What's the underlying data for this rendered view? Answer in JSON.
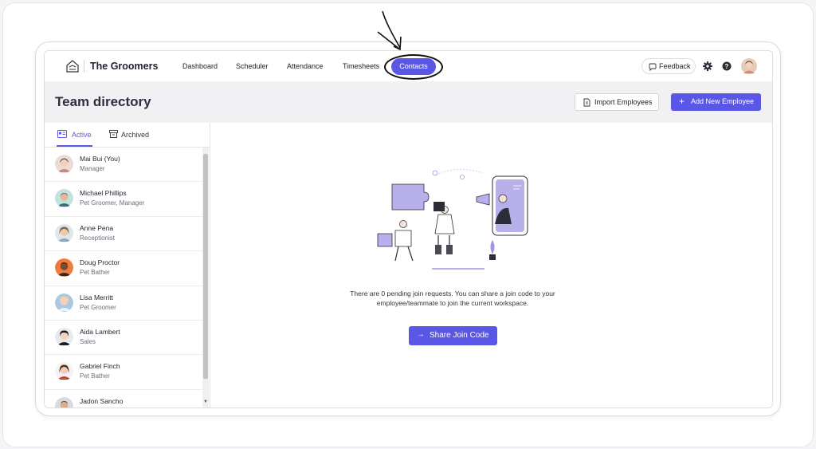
{
  "app": {
    "title": "The Groomers"
  },
  "nav": {
    "items": [
      "Dashboard",
      "Scheduler",
      "Attendance",
      "Timesheets"
    ],
    "active_item": "Contacts",
    "feedback_label": "Feedback"
  },
  "header": {
    "title": "Team directory",
    "import_label": "Import Employees",
    "add_label": "Add New Employee"
  },
  "tabs": {
    "active": "Active",
    "archived": "Archived"
  },
  "employees": [
    {
      "name": "Mai Bui (You)",
      "role": "Manager"
    },
    {
      "name": "Michael Phillips",
      "role": "Pet Groomer, Manager"
    },
    {
      "name": "Anne Pena",
      "role": "Receptionist"
    },
    {
      "name": "Doug Proctor",
      "role": "Pet Bather"
    },
    {
      "name": "Lisa Merritt",
      "role": "Pet Groomer"
    },
    {
      "name": "Aida Lambert",
      "role": "Sales"
    },
    {
      "name": "Gabriel Finch",
      "role": "Pet Bather"
    },
    {
      "name": "Jadon Sancho",
      "role": ""
    }
  ],
  "empty_state": {
    "message": "There are 0 pending join requests. You can share a join code to your employee/teammate to join the current workspace.",
    "button_label": "Share Join Code"
  },
  "colors": {
    "accent": "#5b57e6",
    "illustration": "#9f97e6"
  },
  "icons": [
    "logo-icon",
    "chat-icon",
    "gear-icon",
    "help-icon",
    "document-icon",
    "plus-icon",
    "id-card-icon",
    "archive-icon",
    "arrow-right-icon"
  ]
}
